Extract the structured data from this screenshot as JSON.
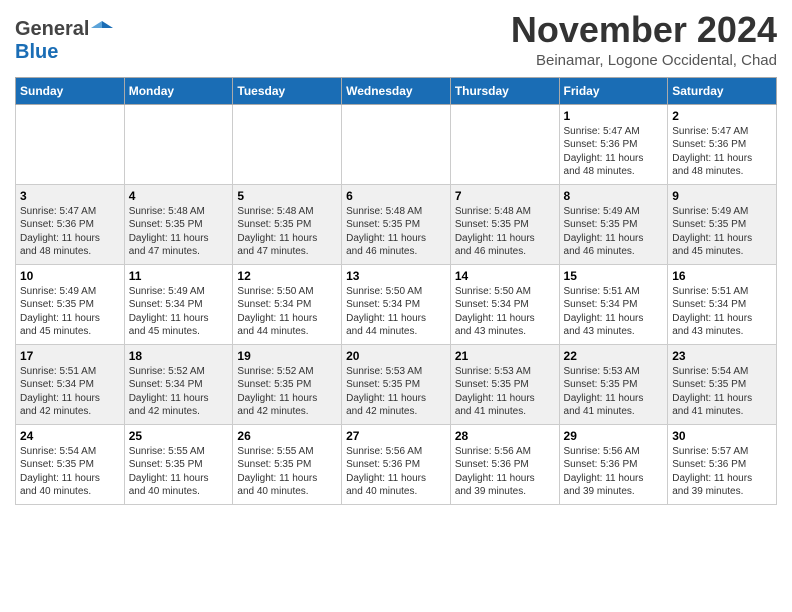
{
  "header": {
    "logo_general": "General",
    "logo_blue": "Blue",
    "month": "November 2024",
    "location": "Beinamar, Logone Occidental, Chad"
  },
  "weekdays": [
    "Sunday",
    "Monday",
    "Tuesday",
    "Wednesday",
    "Thursday",
    "Friday",
    "Saturday"
  ],
  "weeks": [
    [
      {
        "day": "",
        "detail": ""
      },
      {
        "day": "",
        "detail": ""
      },
      {
        "day": "",
        "detail": ""
      },
      {
        "day": "",
        "detail": ""
      },
      {
        "day": "",
        "detail": ""
      },
      {
        "day": "1",
        "detail": "Sunrise: 5:47 AM\nSunset: 5:36 PM\nDaylight: 11 hours\nand 48 minutes."
      },
      {
        "day": "2",
        "detail": "Sunrise: 5:47 AM\nSunset: 5:36 PM\nDaylight: 11 hours\nand 48 minutes."
      }
    ],
    [
      {
        "day": "3",
        "detail": "Sunrise: 5:47 AM\nSunset: 5:36 PM\nDaylight: 11 hours\nand 48 minutes."
      },
      {
        "day": "4",
        "detail": "Sunrise: 5:48 AM\nSunset: 5:35 PM\nDaylight: 11 hours\nand 47 minutes."
      },
      {
        "day": "5",
        "detail": "Sunrise: 5:48 AM\nSunset: 5:35 PM\nDaylight: 11 hours\nand 47 minutes."
      },
      {
        "day": "6",
        "detail": "Sunrise: 5:48 AM\nSunset: 5:35 PM\nDaylight: 11 hours\nand 46 minutes."
      },
      {
        "day": "7",
        "detail": "Sunrise: 5:48 AM\nSunset: 5:35 PM\nDaylight: 11 hours\nand 46 minutes."
      },
      {
        "day": "8",
        "detail": "Sunrise: 5:49 AM\nSunset: 5:35 PM\nDaylight: 11 hours\nand 46 minutes."
      },
      {
        "day": "9",
        "detail": "Sunrise: 5:49 AM\nSunset: 5:35 PM\nDaylight: 11 hours\nand 45 minutes."
      }
    ],
    [
      {
        "day": "10",
        "detail": "Sunrise: 5:49 AM\nSunset: 5:35 PM\nDaylight: 11 hours\nand 45 minutes."
      },
      {
        "day": "11",
        "detail": "Sunrise: 5:49 AM\nSunset: 5:34 PM\nDaylight: 11 hours\nand 45 minutes."
      },
      {
        "day": "12",
        "detail": "Sunrise: 5:50 AM\nSunset: 5:34 PM\nDaylight: 11 hours\nand 44 minutes."
      },
      {
        "day": "13",
        "detail": "Sunrise: 5:50 AM\nSunset: 5:34 PM\nDaylight: 11 hours\nand 44 minutes."
      },
      {
        "day": "14",
        "detail": "Sunrise: 5:50 AM\nSunset: 5:34 PM\nDaylight: 11 hours\nand 43 minutes."
      },
      {
        "day": "15",
        "detail": "Sunrise: 5:51 AM\nSunset: 5:34 PM\nDaylight: 11 hours\nand 43 minutes."
      },
      {
        "day": "16",
        "detail": "Sunrise: 5:51 AM\nSunset: 5:34 PM\nDaylight: 11 hours\nand 43 minutes."
      }
    ],
    [
      {
        "day": "17",
        "detail": "Sunrise: 5:51 AM\nSunset: 5:34 PM\nDaylight: 11 hours\nand 42 minutes."
      },
      {
        "day": "18",
        "detail": "Sunrise: 5:52 AM\nSunset: 5:34 PM\nDaylight: 11 hours\nand 42 minutes."
      },
      {
        "day": "19",
        "detail": "Sunrise: 5:52 AM\nSunset: 5:35 PM\nDaylight: 11 hours\nand 42 minutes."
      },
      {
        "day": "20",
        "detail": "Sunrise: 5:53 AM\nSunset: 5:35 PM\nDaylight: 11 hours\nand 42 minutes."
      },
      {
        "day": "21",
        "detail": "Sunrise: 5:53 AM\nSunset: 5:35 PM\nDaylight: 11 hours\nand 41 minutes."
      },
      {
        "day": "22",
        "detail": "Sunrise: 5:53 AM\nSunset: 5:35 PM\nDaylight: 11 hours\nand 41 minutes."
      },
      {
        "day": "23",
        "detail": "Sunrise: 5:54 AM\nSunset: 5:35 PM\nDaylight: 11 hours\nand 41 minutes."
      }
    ],
    [
      {
        "day": "24",
        "detail": "Sunrise: 5:54 AM\nSunset: 5:35 PM\nDaylight: 11 hours\nand 40 minutes."
      },
      {
        "day": "25",
        "detail": "Sunrise: 5:55 AM\nSunset: 5:35 PM\nDaylight: 11 hours\nand 40 minutes."
      },
      {
        "day": "26",
        "detail": "Sunrise: 5:55 AM\nSunset: 5:35 PM\nDaylight: 11 hours\nand 40 minutes."
      },
      {
        "day": "27",
        "detail": "Sunrise: 5:56 AM\nSunset: 5:36 PM\nDaylight: 11 hours\nand 40 minutes."
      },
      {
        "day": "28",
        "detail": "Sunrise: 5:56 AM\nSunset: 5:36 PM\nDaylight: 11 hours\nand 39 minutes."
      },
      {
        "day": "29",
        "detail": "Sunrise: 5:56 AM\nSunset: 5:36 PM\nDaylight: 11 hours\nand 39 minutes."
      },
      {
        "day": "30",
        "detail": "Sunrise: 5:57 AM\nSunset: 5:36 PM\nDaylight: 11 hours\nand 39 minutes."
      }
    ]
  ]
}
